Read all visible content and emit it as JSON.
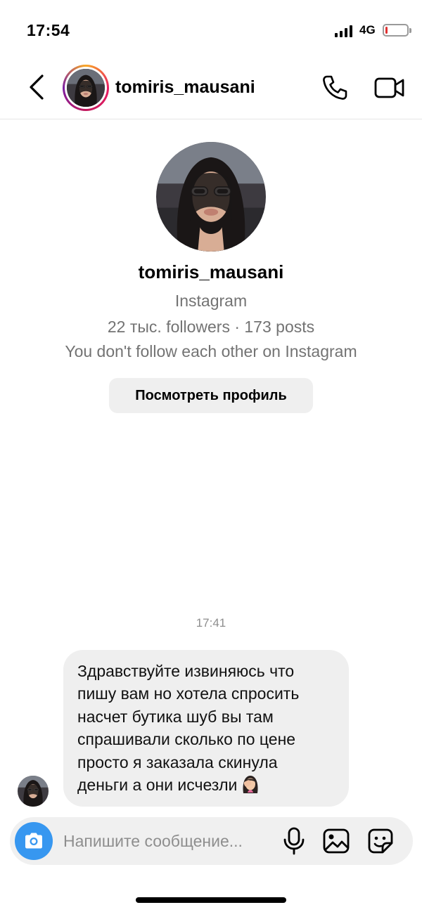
{
  "status_bar": {
    "time": "17:54",
    "network": "4G",
    "battery_level": 0.12,
    "battery_color": "#e03131"
  },
  "header": {
    "username": "tomiris_mausani",
    "back_icon": "chevron-left-icon",
    "call_icon": "phone-icon",
    "video_icon": "video-camera-icon"
  },
  "profile": {
    "name": "tomiris_mausani",
    "source": "Instagram",
    "stats": "22 тыс. followers · 173 posts",
    "relation": "You don't follow each other on Instagram",
    "view_profile_label": "Посмотреть профиль"
  },
  "chat": {
    "timestamp": "17:41",
    "message_lines": [
      "Здравствуйте извиняюсь что",
      "пишу вам но хотела спросить",
      "насчет бутика шуб вы там",
      "спрашивали сколько по цене",
      "просто я заказала скинула",
      "деньги а они исчезли"
    ],
    "message_emoji": "woman-facepalming-emoji"
  },
  "composer": {
    "placeholder": "Напишите сообщение...",
    "accent_color": "#3797f0"
  }
}
